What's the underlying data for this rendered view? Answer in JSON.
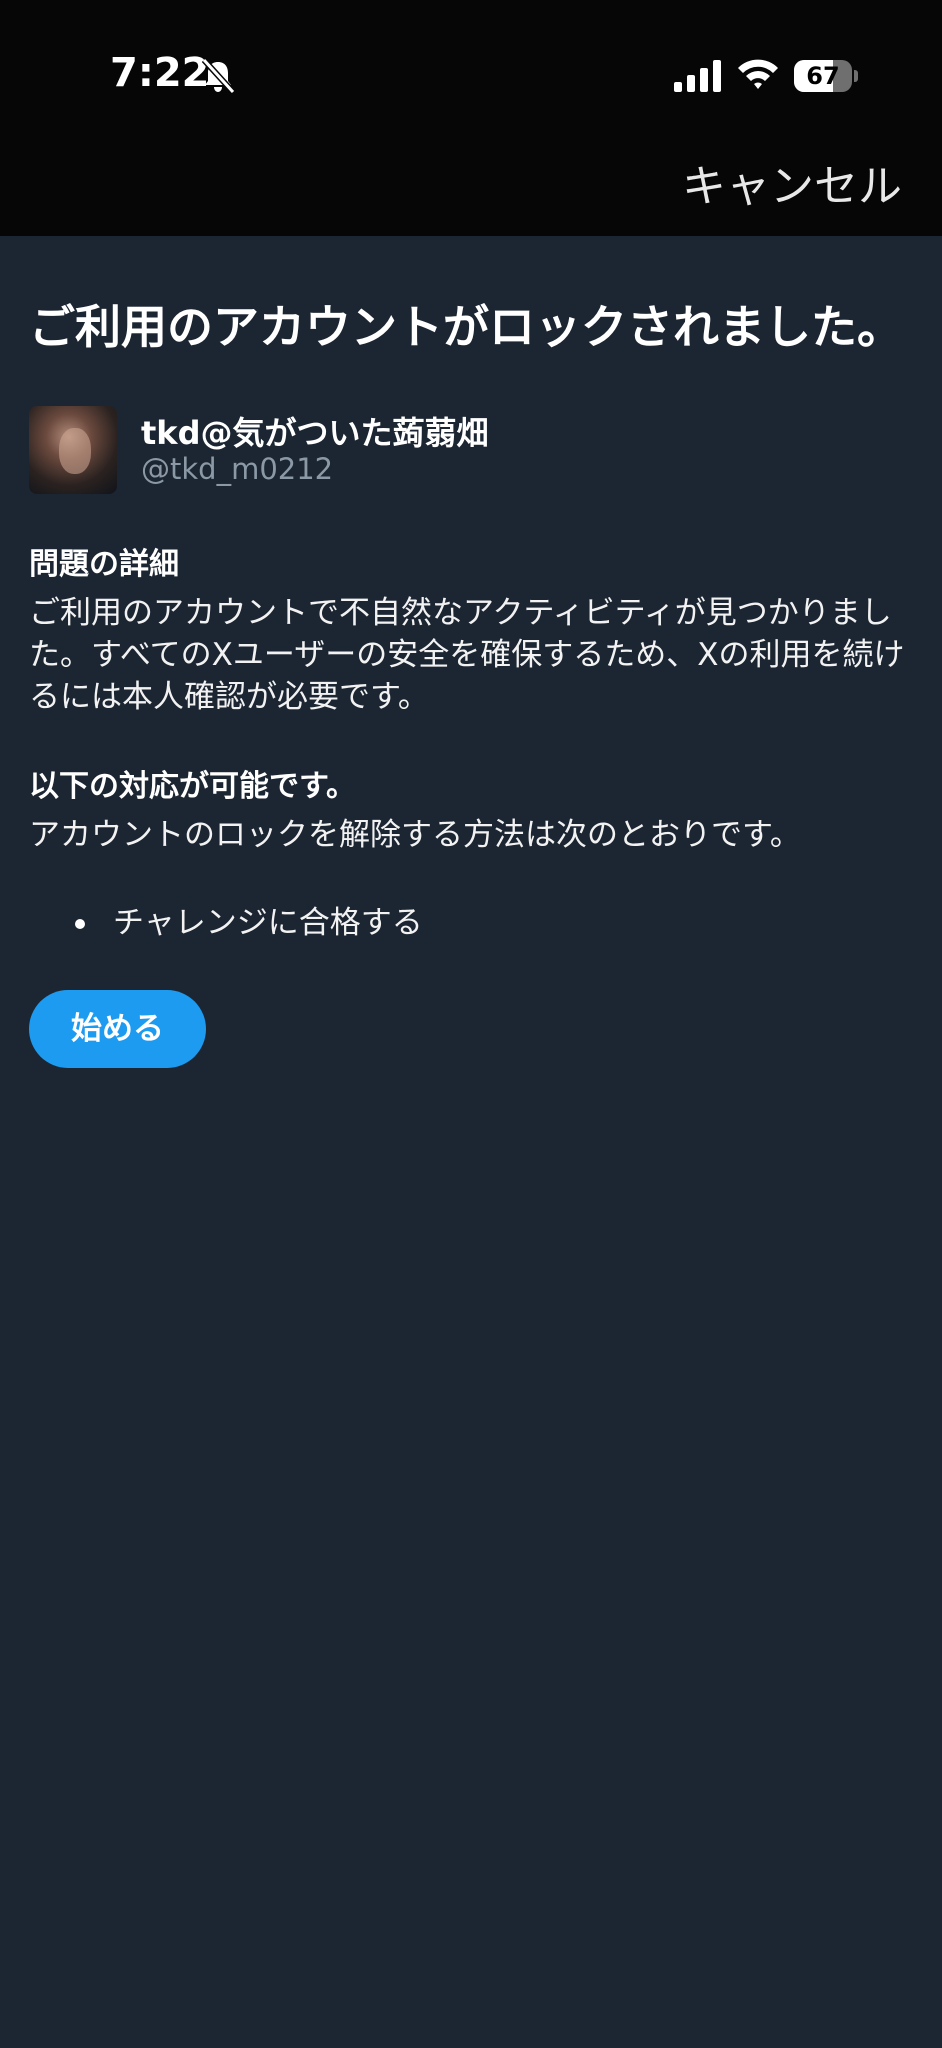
{
  "status_bar": {
    "time": "7:22",
    "battery": "67",
    "battery_level": 0.67,
    "icons": [
      "bell-slash-icon",
      "signal-icon",
      "wifi-icon",
      "battery-icon"
    ]
  },
  "nav": {
    "cancel_label": "キャンセル"
  },
  "page": {
    "title": "ご利用のアカウントがロックされました。"
  },
  "account": {
    "display_name": "tkd@気がついた蒟蒻畑",
    "handle": "@tkd_m0212"
  },
  "details": {
    "heading": "問題の詳細",
    "body": "ご利用のアカウントで不自然なアクティビティが見つかりました。すべてのXユーザーの安全を確保するため、Xの利用を続けるには本人確認が必要です。"
  },
  "options": {
    "heading": "以下の対応が可能です。",
    "body": "アカウントのロックを解除する方法は次のとおりです。",
    "items": [
      "チャレンジに合格する"
    ]
  },
  "actions": {
    "start_label": "始める"
  },
  "colors": {
    "background": "#1c2632",
    "top_bar": "#060606",
    "accent": "#1d9bf0",
    "secondary_text": "#8b98a5"
  }
}
